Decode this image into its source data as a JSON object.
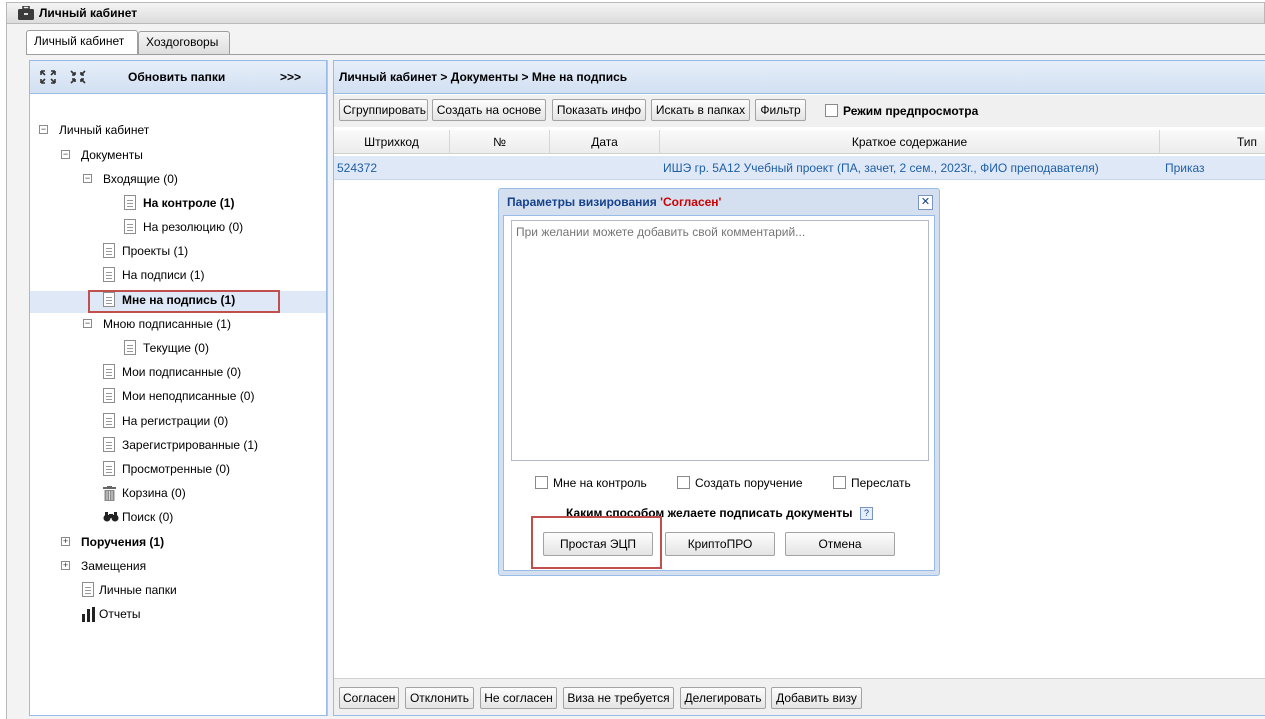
{
  "window": {
    "title": "Личный кабинет"
  },
  "tabs": [
    {
      "label": "Личный кабинет",
      "active": true
    },
    {
      "label": "Хоздоговоры",
      "active": false
    }
  ],
  "left_panel": {
    "refresh_label": "Обновить папки",
    "more_label": ">>>",
    "expand_icon": "expand-all-icon",
    "collapse_icon": "collapse-all-icon",
    "tree": [
      {
        "label": "Личный кабинет",
        "toggle": "⊟"
      },
      {
        "label": "Документы",
        "toggle": "⊟"
      },
      {
        "label": "Входящие (0)",
        "toggle": "⊟"
      },
      {
        "label": "На контроле (1)",
        "bold": true
      },
      {
        "label": "На резолюцию (0)"
      },
      {
        "label": "Проекты (1)"
      },
      {
        "label": "На подписи (1)"
      },
      {
        "label": "Мне на подпись (1)",
        "bold": true,
        "selected": true
      },
      {
        "label": "Мною подписанные (1)",
        "toggle": "⊟"
      },
      {
        "label": "Текущие (0)"
      },
      {
        "label": "Мои подписанные (0)"
      },
      {
        "label": "Мои неподписанные (0)"
      },
      {
        "label": "На регистрации (0)"
      },
      {
        "label": "Зарегистрированные (1)"
      },
      {
        "label": "Просмотренные (0)"
      },
      {
        "label": "Корзина (0)",
        "icon": "trash-icon"
      },
      {
        "label": "Поиск (0)",
        "icon": "binoculars-icon"
      },
      {
        "label": "Поручения (1)",
        "toggle": "⊞",
        "bold": true
      },
      {
        "label": "Замещения",
        "toggle": "⊞"
      },
      {
        "label": "Личные папки"
      },
      {
        "label": "Отчеты",
        "icon": "bar-chart-icon"
      }
    ]
  },
  "main": {
    "breadcrumb": "Личный кабинет > Документы > Мне на подпись",
    "toolbar": {
      "group": "Сгруппировать",
      "create_based": "Создать на основе",
      "show_info": "Показать инфо",
      "search_folders": "Искать в папках",
      "filter": "Фильтр",
      "preview_label": "Режим предпросмотра"
    },
    "columns": [
      "Штрихкод",
      "№",
      "Дата",
      "Краткое содержание",
      "Тип"
    ],
    "rows": [
      {
        "barcode": "524372",
        "number": "",
        "date": "",
        "summary": "ИШЭ гр. 5А12 Учебный проект (ПА, зачет, 2 сем., 2023г., ФИО преподавателя)",
        "type": "Приказ"
      }
    ],
    "bottom_buttons": {
      "agree": "Согласен",
      "reject": "Отклонить",
      "disagree": "Не согласен",
      "no_visa": "Виза не требуется",
      "delegate": "Делегировать",
      "add_visa": "Добавить визу"
    }
  },
  "dialog": {
    "title_prefix": "Параметры визирования ",
    "title_status": "'Согласен'",
    "comment_placeholder": "При желании можете добавить свой комментарий...",
    "checkboxes": {
      "control": "Мне на контроль",
      "create_task": "Создать поручение",
      "forward": "Переслать"
    },
    "question": "Каким способом желаете подписать документы",
    "help_icon": "?",
    "buttons": {
      "simple": "Простая ЭЦП",
      "crypto": "КриптоПРО",
      "cancel": "Отмена"
    }
  },
  "colors": {
    "highlight": "#c0504d",
    "link": "#1f5fa6",
    "selection": "#dfe8f6",
    "panel_border": "#99bbe8"
  }
}
